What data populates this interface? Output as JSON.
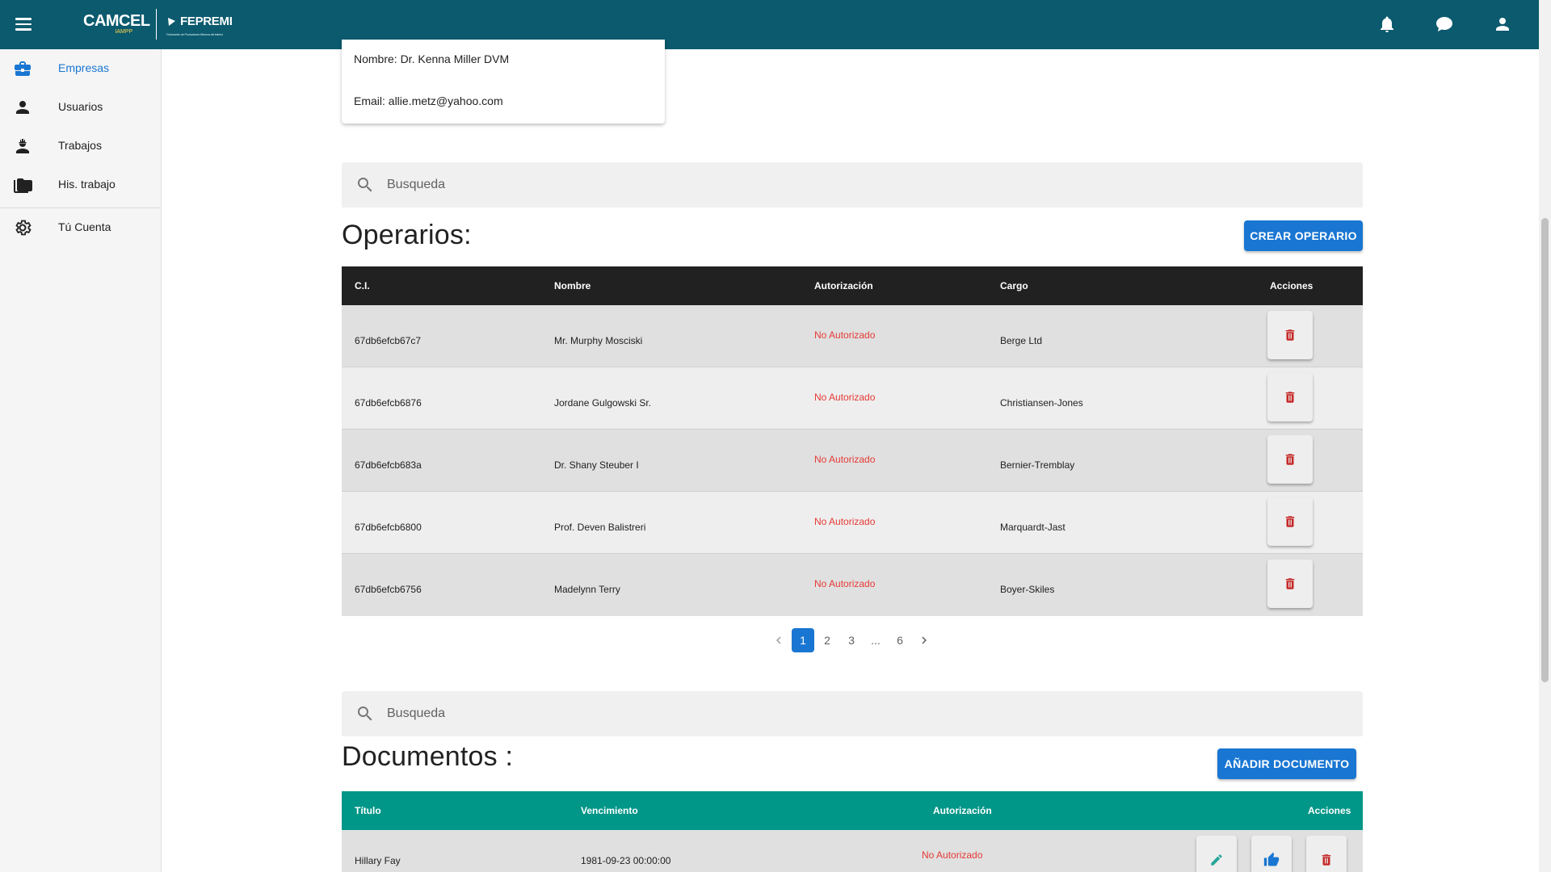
{
  "header": {
    "brand_primary": "CAMCEL",
    "brand_primary_sub": "IAMPP",
    "brand_secondary": "FEPREMI",
    "brand_secondary_sub": "Federación de Productores Mineros del Interior",
    "bar_color": "#0b5a6e"
  },
  "sidebar": {
    "items": [
      {
        "label": "Empresas",
        "icon": "briefcase-icon",
        "active": true
      },
      {
        "label": "Usuarios",
        "icon": "person-icon",
        "active": false
      },
      {
        "label": "Trabajos",
        "icon": "worker-icon",
        "active": false
      },
      {
        "label": "His. trabajo",
        "icon": "folder-icon",
        "active": false
      },
      {
        "label": "Tú Cuenta",
        "icon": "gear-icon",
        "active": false
      }
    ]
  },
  "company_card": {
    "name": "Nombre: Dr. Kenna Miller DVM",
    "email": "Email: allie.metz@yahoo.com"
  },
  "operators_section": {
    "search_placeholder": "Busqueda",
    "title": "Operarios:",
    "create_button": "CREAR OPERARIO",
    "columns": [
      "C.I.",
      "Nombre",
      "Autorización",
      "Cargo",
      "Acciones"
    ],
    "rows": [
      {
        "ci": "67db6efcb67c7",
        "nombre": "Mr. Murphy Mosciski",
        "autorizacion": "No Autorizado",
        "cargo": "Berge Ltd"
      },
      {
        "ci": "67db6efcb6876",
        "nombre": "Jordane Gulgowski Sr.",
        "autorizacion": "No Autorizado",
        "cargo": "Christiansen-Jones"
      },
      {
        "ci": "67db6efcb683a",
        "nombre": "Dr. Shany Steuber I",
        "autorizacion": "No Autorizado",
        "cargo": "Bernier-Tremblay"
      },
      {
        "ci": "67db6efcb6800",
        "nombre": "Prof. Deven Balistreri",
        "autorizacion": "No Autorizado",
        "cargo": "Marquardt-Jast"
      },
      {
        "ci": "67db6efcb6756",
        "nombre": "Madelynn Terry",
        "autorizacion": "No Autorizado",
        "cargo": "Boyer-Skiles"
      }
    ],
    "pagination": {
      "pages": [
        "1",
        "2",
        "3",
        "...",
        "6"
      ],
      "current": "1"
    },
    "header_color": "#212121"
  },
  "documents_section": {
    "search_placeholder": "Busqueda",
    "title": "Documentos :",
    "add_button": "AÑADIR DOCUMENTO",
    "columns": [
      "Título",
      "Vencimiento",
      "Autorización",
      "Acciones"
    ],
    "rows": [
      {
        "titulo": "Hillary Fay",
        "vencimiento": "1981-09-23 00:00:00",
        "autorizacion": "No Autorizado"
      }
    ],
    "header_color": "#009688"
  },
  "colors": {
    "accent": "#1976d2",
    "danger": "#c62828",
    "status_red": "#e53935",
    "edit_teal": "#26a69a"
  }
}
